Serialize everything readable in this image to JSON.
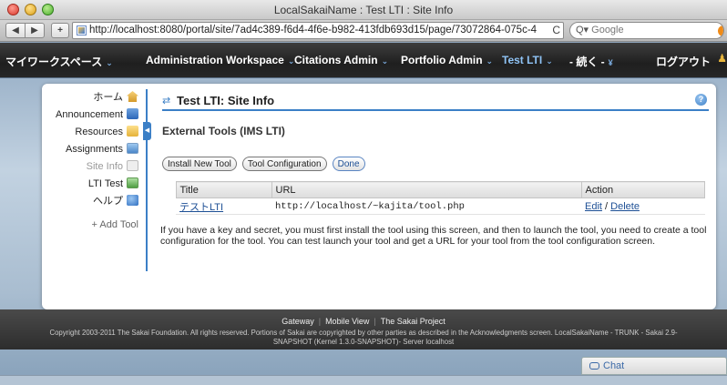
{
  "window": {
    "title": "LocalSakaiName : Test LTI : Site Info"
  },
  "browser": {
    "back_label": "◀",
    "forward_label": "▶",
    "add_label": "+",
    "url": "http://localhost:8080/portal/site/7ad4c389-f6d4-4f6e-b982-413fdb693d15/page/73072864-075c-4",
    "reload_label": "C",
    "search_placeholder": "Google",
    "search_glyph": "Q▾"
  },
  "sitenav": {
    "tabs": [
      {
        "label": "マイワークスペース",
        "arrow": "⌄"
      },
      {
        "label": "Administration Workspace",
        "arrow": "⌄"
      },
      {
        "label": "Citations Admin",
        "arrow": "⌄"
      },
      {
        "label": "Portfolio Admin",
        "arrow": "⌄"
      },
      {
        "label": "Test LTI",
        "arrow": "⌄"
      },
      {
        "label": "- 続く -",
        "arrow": "¥"
      }
    ],
    "logout": "ログアウト"
  },
  "toolmenu": {
    "items": [
      {
        "label": "ホーム",
        "icon": "home-icon"
      },
      {
        "label": "Announcement",
        "icon": "announcement-icon"
      },
      {
        "label": "Resources",
        "icon": "folder-icon"
      },
      {
        "label": "Assignments",
        "icon": "assignments-icon"
      },
      {
        "label": "Site Info",
        "icon": "site-info-icon"
      },
      {
        "label": "LTI Test",
        "icon": "lti-icon"
      },
      {
        "label": "ヘルプ",
        "icon": "help-icon"
      }
    ],
    "add_tool": "+ Add Tool"
  },
  "tool": {
    "title": "Test LTI: Site Info",
    "section_title": "External Tools (IMS LTI)",
    "buttons": {
      "install": "Install New Tool",
      "config": "Tool Configuration",
      "done": "Done"
    },
    "table": {
      "headers": {
        "title": "Title",
        "url": "URL",
        "action": "Action"
      },
      "rows": [
        {
          "title": "テストLTI",
          "url": "http://localhost/~kajita/tool.php",
          "edit": "Edit",
          "sep": "/",
          "delete": "Delete"
        }
      ]
    },
    "instructions": "If you have a key and secret, you must first install the tool using this screen, and then to launch the tool, you need to create a tool configuration for the tool. You can test launch your tool and get a URL for your tool from the tool configuration screen."
  },
  "footer": {
    "links": [
      "Gateway",
      "Mobile View",
      "The Sakai Project"
    ],
    "copyright_1": "Copyright 2003-2011 The Sakai Foundation. All rights reserved. Portions of Sakai are copyrighted by other parties as described in the Acknowledgments screen. LocalSakaiName - TRUNK - Sakai 2.9-",
    "copyright_2": "SNAPSHOT (Kernel 1.3.0-SNAPSHOT)- Server localhost"
  },
  "chat": {
    "label": "Chat"
  },
  "colors": {
    "accent": "#3b7fc6",
    "nav_bg": "#262626",
    "active_tab": "#8fc3f5"
  }
}
